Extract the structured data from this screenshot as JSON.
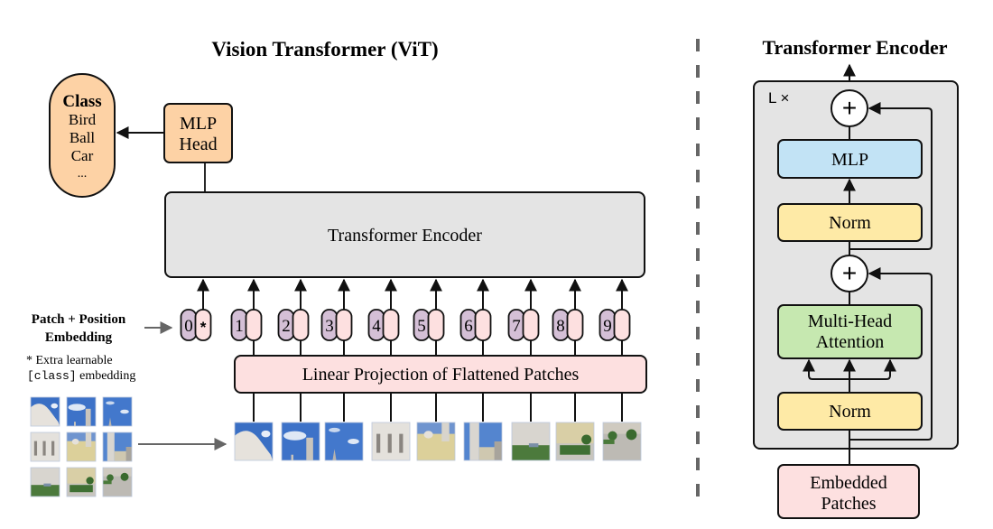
{
  "vit": {
    "title": "Vision Transformer (ViT)",
    "class_box": {
      "heading": "Class",
      "items": [
        "Bird",
        "Ball",
        "Car",
        "..."
      ]
    },
    "mlp_head": {
      "line1": "MLP",
      "line2": "Head"
    },
    "encoder_label": "Transformer Encoder",
    "linear_projection_label": "Linear Projection of Flattened Patches",
    "embedding_label": {
      "line1": "Patch + Position",
      "line2": "Embedding"
    },
    "footnote": {
      "line1": "* Extra learnable",
      "line2_code": "[class]",
      "line2_text": " embedding"
    },
    "tokens": [
      {
        "position": "0",
        "patch": "*"
      },
      {
        "position": "1",
        "patch": ""
      },
      {
        "position": "2",
        "patch": ""
      },
      {
        "position": "3",
        "patch": ""
      },
      {
        "position": "4",
        "patch": ""
      },
      {
        "position": "5",
        "patch": ""
      },
      {
        "position": "6",
        "patch": ""
      },
      {
        "position": "7",
        "patch": ""
      },
      {
        "position": "8",
        "patch": ""
      },
      {
        "position": "9",
        "patch": ""
      }
    ],
    "patches": [
      {
        "name": "dome",
        "sky": "#3a6fc4",
        "main": "#e6e2dc"
      },
      {
        "name": "sky-tower",
        "sky": "#3d72c8",
        "main": "#c9c4bc"
      },
      {
        "name": "sky-spire",
        "sky": "#4378cc",
        "main": "#b8b4ae"
      },
      {
        "name": "facade-white",
        "sky": "#d8d6d2",
        "main": "#e4e1dc"
      },
      {
        "name": "facade-yellow",
        "sky": "#6f94cf",
        "main": "#dcd09a"
      },
      {
        "name": "tower-right",
        "sky": "#5485cf",
        "main": "#cfc8b0"
      },
      {
        "name": "courtyard-left",
        "sky": "#d6d3cd",
        "main": "#4c7a3c"
      },
      {
        "name": "courtyard-mid",
        "sky": "#d9cfa6",
        "main": "#3f7033"
      },
      {
        "name": "courtyard-right",
        "sky": "#cfcac0",
        "main": "#bdbab4"
      }
    ]
  },
  "encoder_detail": {
    "title": "Transformer Encoder",
    "repeat_label": "L ×",
    "plus_symbol": "+",
    "mlp_label": "MLP",
    "norm_top_label": "Norm",
    "mha": {
      "line1": "Multi-Head",
      "line2": "Attention"
    },
    "norm_bottom_label": "Norm",
    "embedded": {
      "line1": "Embedded",
      "line2": "Patches"
    }
  },
  "colors": {
    "orange": "#fdd2a5",
    "gray_block": "#e4e4e4",
    "pink": "#fde0e0",
    "purple": "#d4bfd6",
    "blue": "#c2e3f5",
    "yellow": "#feeaa6",
    "green": "#c6e8b0",
    "stroke": "#111111",
    "dash": "#666666"
  }
}
